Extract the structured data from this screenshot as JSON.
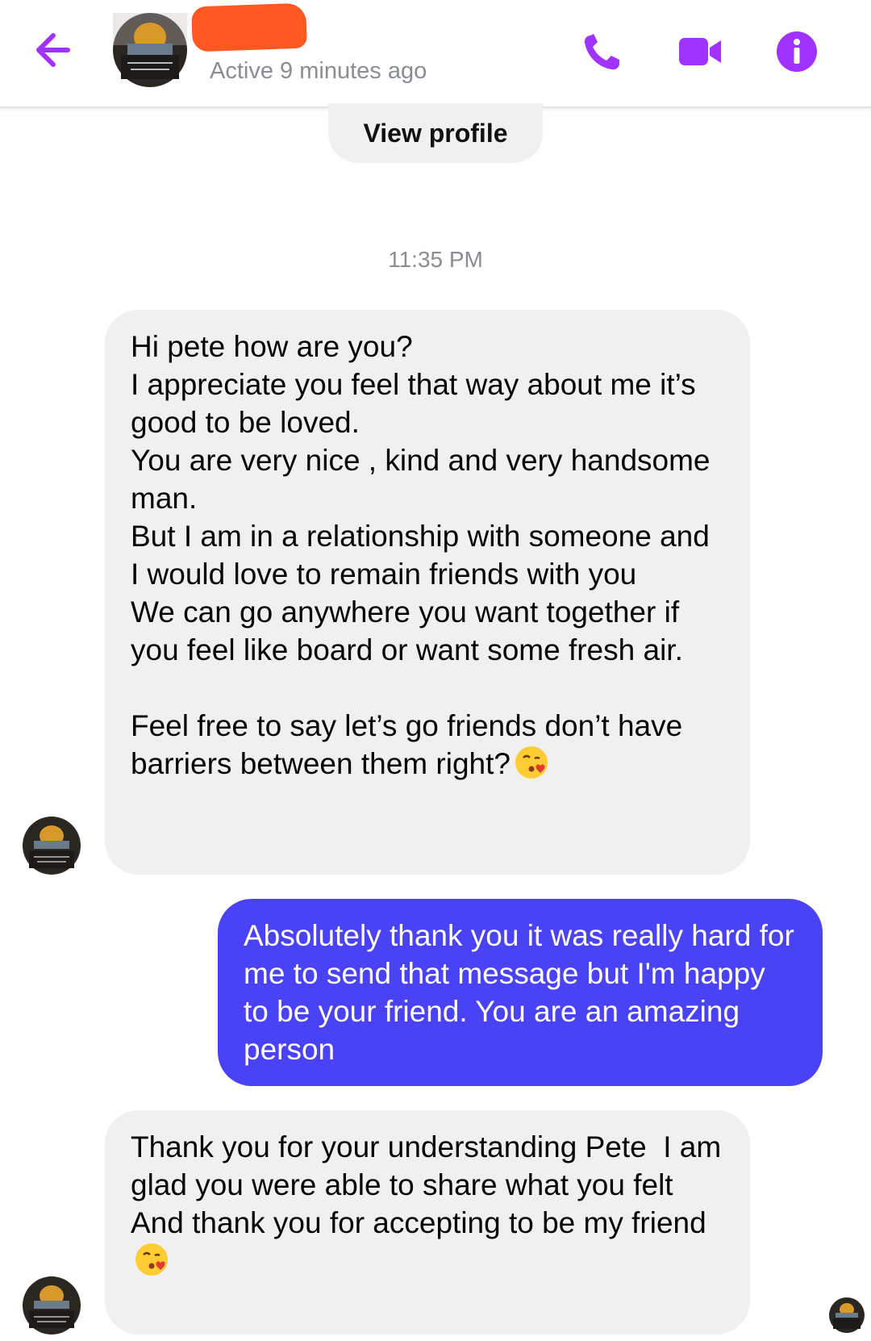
{
  "header": {
    "contact_name": "",
    "status": "Active 9 minutes ago",
    "icons": {
      "back": "arrow-left-icon",
      "call": "phone-icon",
      "video": "video-camera-icon",
      "info": "info-icon"
    }
  },
  "view_profile_label": "View profile",
  "timestamp": "11:35 PM",
  "messages": [
    {
      "direction": "incoming",
      "text": "Hi pete how are you?\nI appreciate you feel that way about me it’s good to be loved.\nYou are very nice , kind and very handsome man.\nBut I am in a relationship with someone and I would love to remain friends with you\nWe can go anywhere you want together if you feel like board or want some fresh air.\n\nFeel free to say let’s go friends don’t have barriers between them right?",
      "emoji": "face-blowing-kiss"
    },
    {
      "direction": "outgoing",
      "text": "Absolutely thank you it was really hard for me to send that message but I'm happy to be your friend. You are an amazing person"
    },
    {
      "direction": "incoming",
      "text": "Thank you for your understanding Pete  I am glad you were able to share what you felt\nAnd thank you for accepting to be my friend ",
      "emoji": "face-blowing-kiss"
    }
  ],
  "colors": {
    "accent": "#a033ff",
    "outgoing_bubble": "#4a42f5",
    "incoming_bubble": "#f0f0f0",
    "redaction": "#ff5722"
  }
}
